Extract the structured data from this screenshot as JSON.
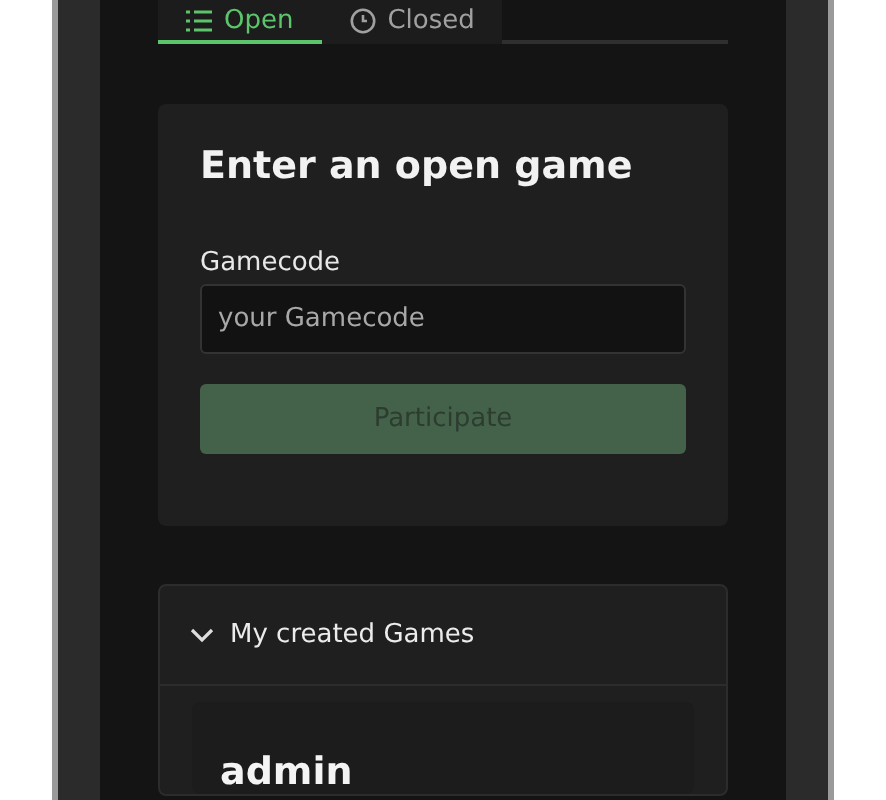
{
  "tabs": [
    {
      "label": "Open",
      "kind": "list",
      "selected": true
    },
    {
      "label": "Closed",
      "kind": "clock",
      "selected": false
    }
  ],
  "join_card": {
    "title": "Enter an open game",
    "field_label": "Gamecode",
    "placeholder": "your Gamecode",
    "button": "Participate",
    "button_disabled": true
  },
  "created_games": {
    "title": "My created Games",
    "expanded": true,
    "games": [
      {
        "owner": "admin"
      }
    ]
  }
}
